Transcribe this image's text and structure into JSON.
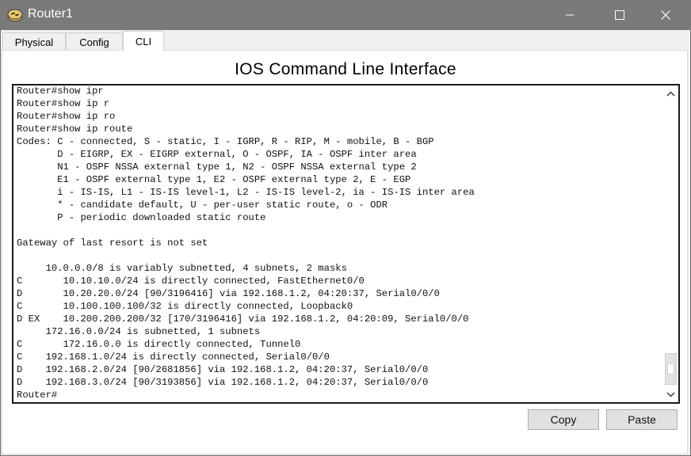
{
  "window": {
    "title": "Router1",
    "app_icon": "router-icon",
    "controls": [
      "minimize-icon",
      "maximize-icon",
      "close-icon"
    ]
  },
  "tabs": [
    {
      "label": "Physical",
      "active": false
    },
    {
      "label": "Config",
      "active": false
    },
    {
      "label": "CLI",
      "active": true
    }
  ],
  "cli": {
    "heading": "IOS Command Line Interface",
    "lines": [
      "Router#show ipr",
      "Router#show ip r",
      "Router#show ip ro",
      "Router#show ip route",
      "Codes: C - connected, S - static, I - IGRP, R - RIP, M - mobile, B - BGP",
      "       D - EIGRP, EX - EIGRP external, O - OSPF, IA - OSPF inter area",
      "       N1 - OSPF NSSA external type 1, N2 - OSPF NSSA external type 2",
      "       E1 - OSPF external type 1, E2 - OSPF external type 2, E - EGP",
      "       i - IS-IS, L1 - IS-IS level-1, L2 - IS-IS level-2, ia - IS-IS inter area",
      "       * - candidate default, U - per-user static route, o - ODR",
      "       P - periodic downloaded static route",
      "",
      "Gateway of last resort is not set",
      "",
      "     10.0.0.0/8 is variably subnetted, 4 subnets, 2 masks",
      "C       10.10.10.0/24 is directly connected, FastEthernet0/0",
      "D       10.20.20.0/24 [90/3196416] via 192.168.1.2, 04:20:37, Serial0/0/0",
      "C       10.100.100.100/32 is directly connected, Loopback0",
      "D EX    10.200.200.200/32 [170/3196416] via 192.168.1.2, 04:20:09, Serial0/0/0",
      "     172.16.0.0/24 is subnetted, 1 subnets",
      "C       172.16.0.0 is directly connected, Tunnel0",
      "C    192.168.1.0/24 is directly connected, Serial0/0/0",
      "D    192.168.2.0/24 [90/2681856] via 192.168.1.2, 04:20:37, Serial0/0/0",
      "D    192.168.3.0/24 [90/3193856] via 192.168.1.2, 04:20:37, Serial0/0/0",
      "Router#"
    ]
  },
  "buttons": {
    "copy": "Copy",
    "paste": "Paste"
  },
  "colors": {
    "titlebar": "#7a7a7a",
    "console_border": "#1a1a1a",
    "button_face": "#e1e1e1"
  }
}
